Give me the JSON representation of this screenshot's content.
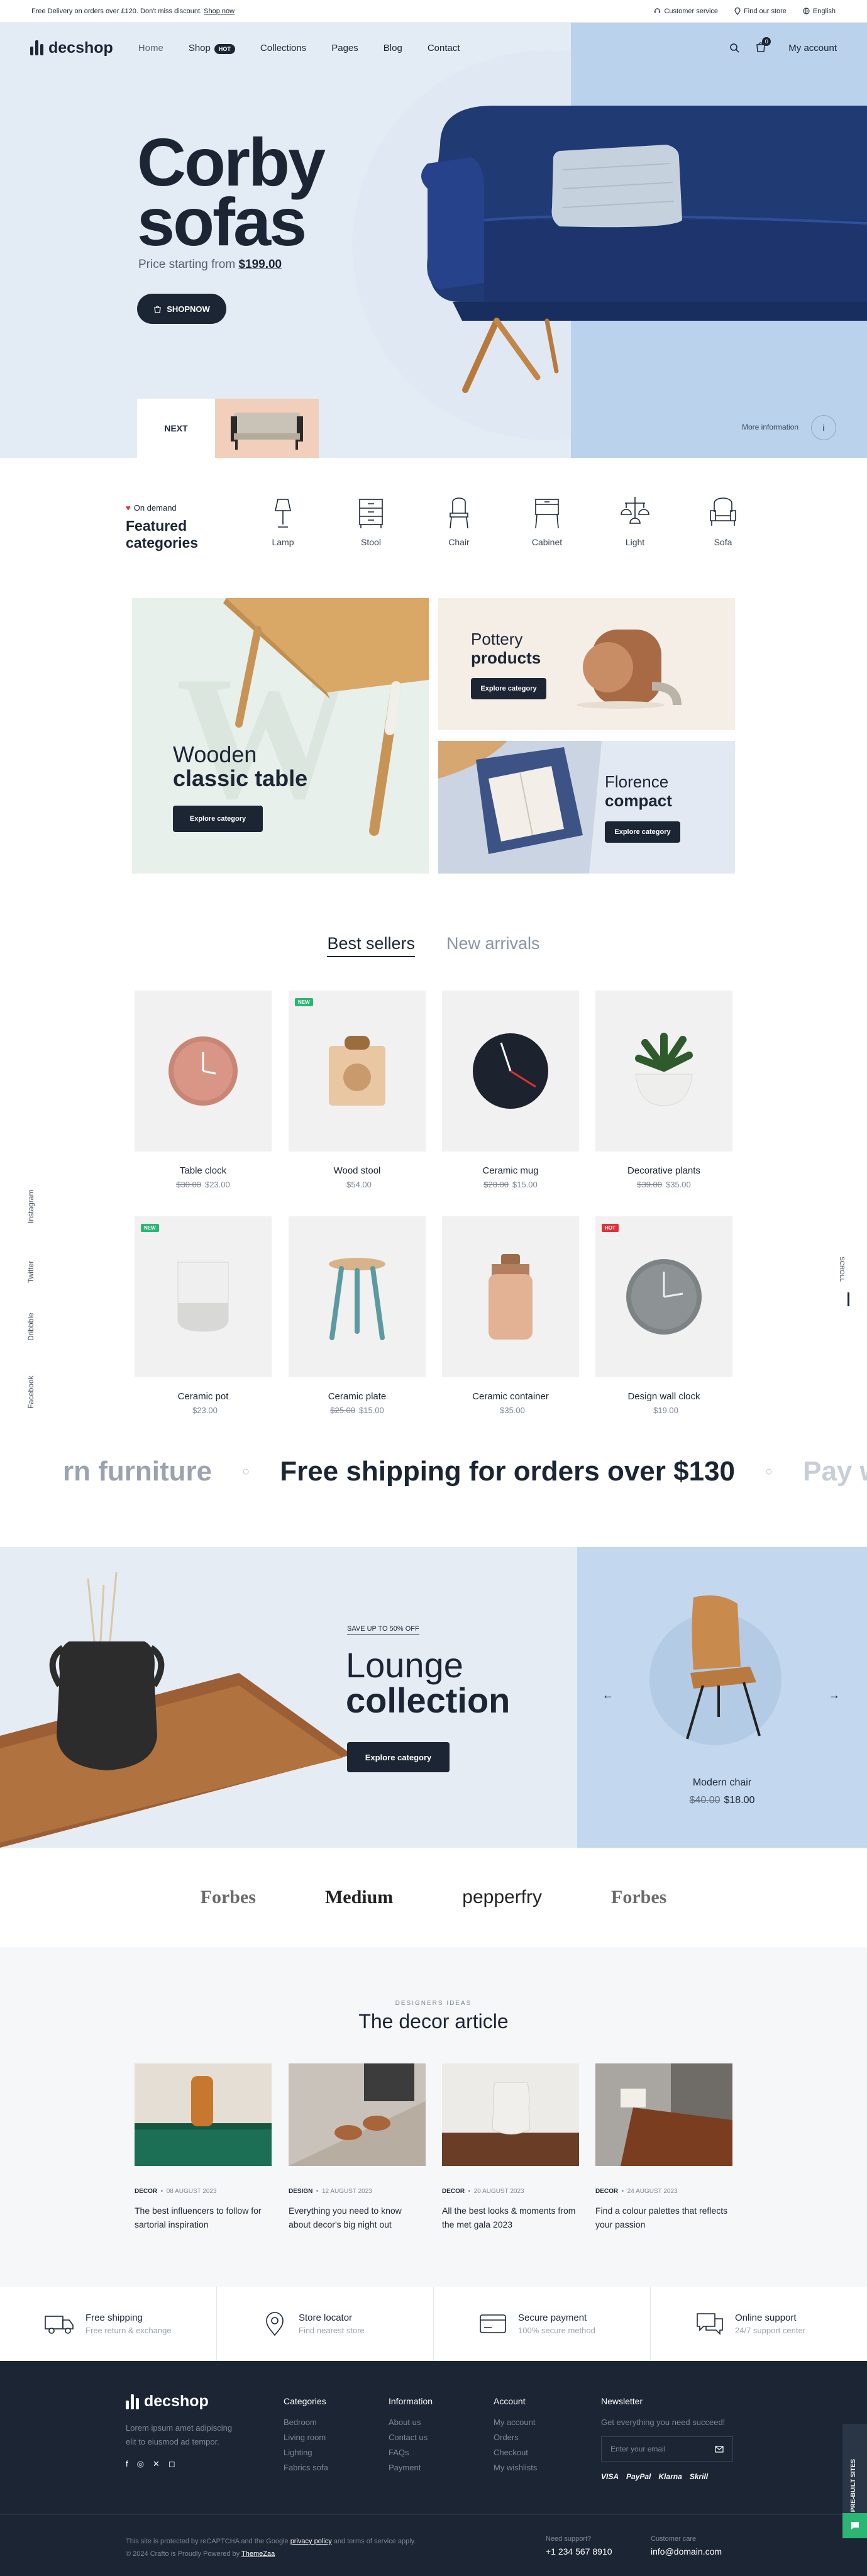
{
  "topbar": {
    "promo": "Free Delivery on orders over £120.  Don't miss discount.",
    "promo_link": "Shop now",
    "customer_service": "Customer service",
    "find_store": "Find our store",
    "language": "English"
  },
  "nav": {
    "logo": "decshop",
    "items": [
      "Home",
      "Shop",
      "Collections",
      "Pages",
      "Blog",
      "Contact"
    ],
    "hot_badge": "HOT",
    "cart_count": "0",
    "account": "My account"
  },
  "hero": {
    "title_line1": "Corby",
    "title_line2": "sofas",
    "price_prefix": "Price starting from",
    "price": "$199.00",
    "cta": "SHOPNOW",
    "next": "NEXT",
    "more_info": "More information"
  },
  "categories": {
    "tag": "On demand",
    "title_line1": "Featured",
    "title_line2": "categories",
    "items": [
      "Lamp",
      "Stool",
      "Chair",
      "Cabinet",
      "Light",
      "Sofa"
    ]
  },
  "tiles": {
    "big": {
      "line1": "Wooden",
      "line2": "classic table",
      "cta": "Explore category"
    },
    "pottery": {
      "line1": "Pottery",
      "line2": "products",
      "cta": "Explore category"
    },
    "florence": {
      "line1": "Florence",
      "line2": "compact",
      "cta": "Explore category"
    }
  },
  "tabs": {
    "active": "Best sellers",
    "inactive": "New arrivals"
  },
  "products": [
    {
      "name": "Table clock",
      "old": "$30.00",
      "price": "$23.00",
      "badge": ""
    },
    {
      "name": "Wood stool",
      "old": "",
      "price": "$54.00",
      "badge": "NEW"
    },
    {
      "name": "Ceramic mug",
      "old": "$20.00",
      "price": "$15.00",
      "badge": ""
    },
    {
      "name": "Decorative plants",
      "old": "$39.00",
      "price": "$35.00",
      "badge": ""
    },
    {
      "name": "Ceramic pot",
      "old": "",
      "price": "$23.00",
      "badge": "NEW"
    },
    {
      "name": "Ceramic plate",
      "old": "$25.00",
      "price": "$15.00",
      "badge": ""
    },
    {
      "name": "Ceramic container",
      "old": "",
      "price": "$35.00",
      "badge": ""
    },
    {
      "name": "Design wall clock",
      "old": "",
      "price": "$19.00",
      "badge": "HOT"
    }
  ],
  "social": [
    "Instagram",
    "Twitter",
    "Dribbble",
    "Facebook"
  ],
  "scroll_top": "SCROLL",
  "marquee": {
    "left": "rn furniture",
    "center": "Free shipping for orders over $130",
    "right": "Pay w"
  },
  "lounge": {
    "tag": "SAVE UP TO 50% OFF",
    "line1": "Lounge",
    "line2": "collection",
    "cta": "Explore category",
    "product_name": "Modern chair",
    "product_old": "$40.00",
    "product_price": "$18.00"
  },
  "brands": [
    "Forbes",
    "Medium",
    "pepperfry",
    "Forbes"
  ],
  "articles_section": {
    "tag": "DESIGNERS IDEAS",
    "title": "The decor article",
    "items": [
      {
        "cat": "DECOR",
        "date": "08 AUGUST 2023",
        "title": "The best influencers to follow for sartorial inspiration"
      },
      {
        "cat": "DESIGN",
        "date": "12 AUGUST 2023",
        "title": "Everything you need to know about decor's big night out"
      },
      {
        "cat": "DECOR",
        "date": "20 AUGUST 2023",
        "title": "All the best looks & moments from the met gala 2023"
      },
      {
        "cat": "DECOR",
        "date": "24 AUGUST 2023",
        "title": "Find a colour palettes that reflects your passion"
      }
    ]
  },
  "features": [
    {
      "title": "Free shipping",
      "sub": "Free return & exchange"
    },
    {
      "title": "Store locator",
      "sub": "Find nearest store"
    },
    {
      "title": "Secure payment",
      "sub": "100% secure method"
    },
    {
      "title": "Online support",
      "sub": "24/7 support center"
    }
  ],
  "footer": {
    "logo": "decshop",
    "about": "Lorem ipsum amet adipiscing elit to eiusmod ad tempor.",
    "categories": {
      "title": "Categories",
      "links": [
        "Bedroom",
        "Living room",
        "Lighting",
        "Fabrics sofa"
      ]
    },
    "information": {
      "title": "Information",
      "links": [
        "About us",
        "Contact us",
        "FAQs",
        "Payment"
      ]
    },
    "account": {
      "title": "Account",
      "links": [
        "My account",
        "Orders",
        "Checkout",
        "My wishlists"
      ]
    },
    "newsletter": {
      "title": "Newsletter",
      "sub": "Get everything you need succeed!",
      "placeholder": "Enter your email"
    },
    "payments": [
      "VISA",
      "PayPal",
      "Klarna",
      "Skrill"
    ],
    "legal1": "This site is protected by reCAPTCHA and the Google",
    "privacy": "privacy policy",
    "legal1b": "and terms of service apply.",
    "legal2": "© 2024 Crafto is Proudly Powered by",
    "powered": "ThemeZaa",
    "support_label": "Need support?",
    "support_phone": "+1 234 567 8910",
    "care_label": "Customer care",
    "care_email": "info@domain.com",
    "prebuilt": "52+ PRE-BUILT SITES"
  },
  "colors": {
    "navy": "#1b2533",
    "hero_bg": "#e3ecf5",
    "hero_right": "#bad2ec",
    "sale_red": "#e0313b",
    "new_green": "#2bb673"
  }
}
